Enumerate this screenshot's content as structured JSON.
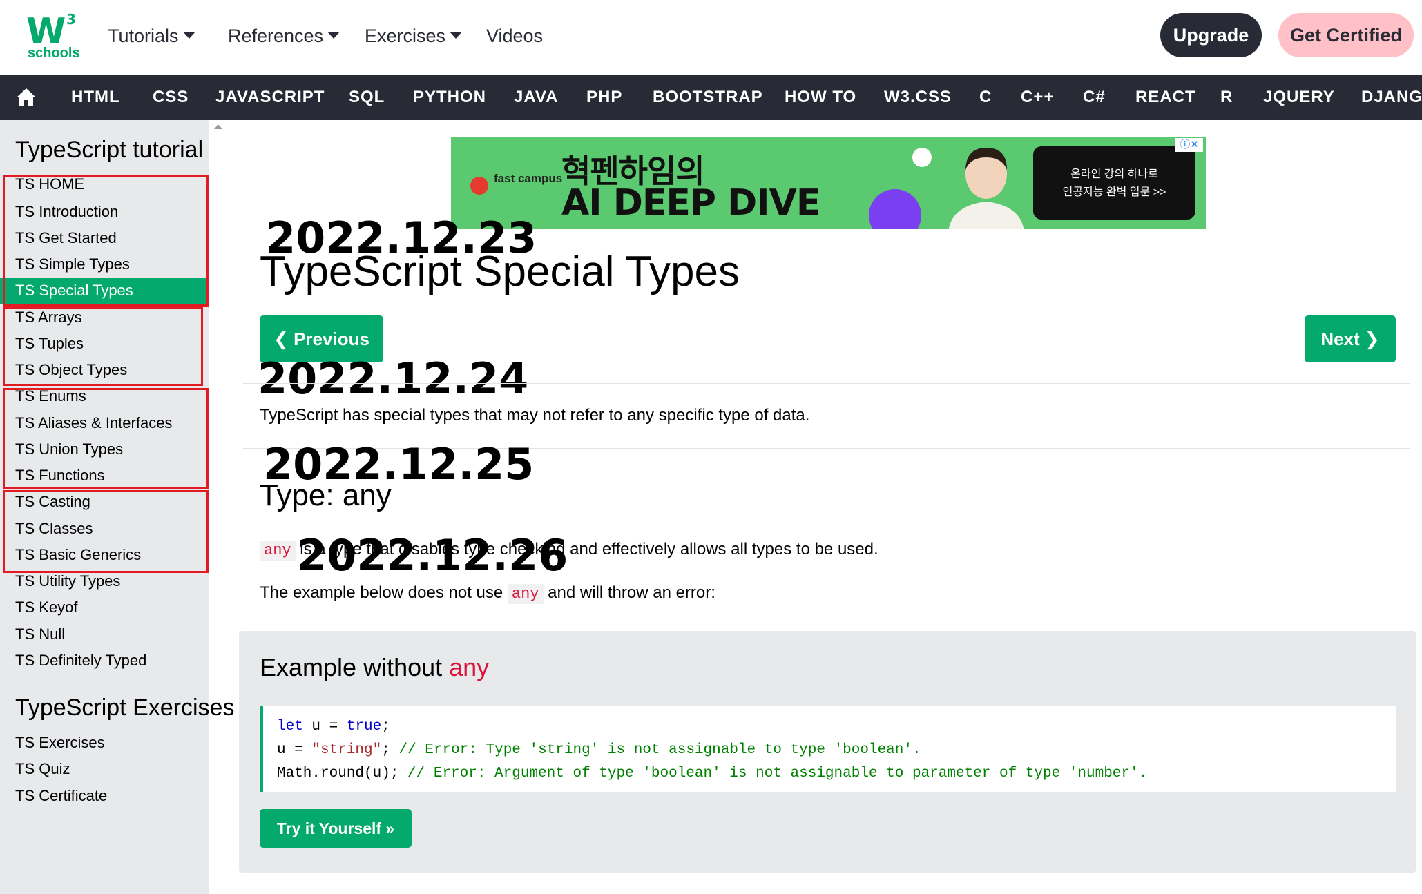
{
  "header": {
    "logo_text": "schools",
    "logo_mark": "W",
    "logo_sup": "3",
    "nav": [
      "Tutorials",
      "References",
      "Exercises",
      "Videos"
    ],
    "upgrade": "Upgrade",
    "get_certified": "Get Certified"
  },
  "topics": [
    "HTML",
    "CSS",
    "JAVASCRIPT",
    "SQL",
    "PYTHON",
    "JAVA",
    "PHP",
    "BOOTSTRAP",
    "HOW TO",
    "W3.CSS",
    "C",
    "C++",
    "C#",
    "REACT",
    "R",
    "JQUERY",
    "DJANGO"
  ],
  "sidebar": {
    "heading": "TypeScript tutorial",
    "items": [
      "TS HOME",
      "TS Introduction",
      "TS Get Started",
      "TS Simple Types",
      "TS Special Types",
      "TS Arrays",
      "TS Tuples",
      "TS Object Types",
      "TS Enums",
      "TS Aliases & Interfaces",
      "TS Union Types",
      "TS Functions",
      "TS Casting",
      "TS Classes",
      "TS Basic Generics",
      "TS Utility Types",
      "TS Keyof",
      "TS Null",
      "TS Definitely Typed"
    ],
    "active_item": "TS Special Types",
    "exercises_heading": "TypeScript Exercises",
    "exercise_items": [
      "TS Exercises",
      "TS Quiz",
      "TS Certificate"
    ]
  },
  "ad": {
    "brand": "fast campus",
    "line1": "혁펜하임의",
    "line2": "AI DEEP DIVE",
    "cta_line1": "온라인 강의 하나로",
    "cta_line2": "인공지능 완벽 입문 >>",
    "close": "ⓘ✕"
  },
  "dates": [
    "2022.12.23",
    "2022.12.24",
    "2022.12.25",
    "2022.12.26"
  ],
  "main": {
    "title": "TypeScript Special Types",
    "prev": "❮ Previous",
    "next": "Next ❯",
    "intro": "TypeScript has special types that may not refer to any specific type of data.",
    "section_title": "Type: any",
    "any_kw": "any",
    "para1_rest": " is a type that disables type checking and effectively allows all types to be used.",
    "para2_start": "The example below does not use ",
    "para2_end": " and will throw an error:",
    "example_title": "Example without ",
    "code": {
      "l1_k": "let",
      "l1_mid": " u = ",
      "l1_v": "true",
      "l1_end": ";",
      "l2_start": "u = ",
      "l2_s": "\"string\"",
      "l2_mid": "; ",
      "l2_c": "// Error: Type 'string' is not assignable to type 'boolean'.",
      "l3_start": "Math.round(u); ",
      "l3_c": "// Error: Argument of type 'boolean' is not assignable to parameter of type 'number'."
    },
    "try": "Try it Yourself »"
  }
}
